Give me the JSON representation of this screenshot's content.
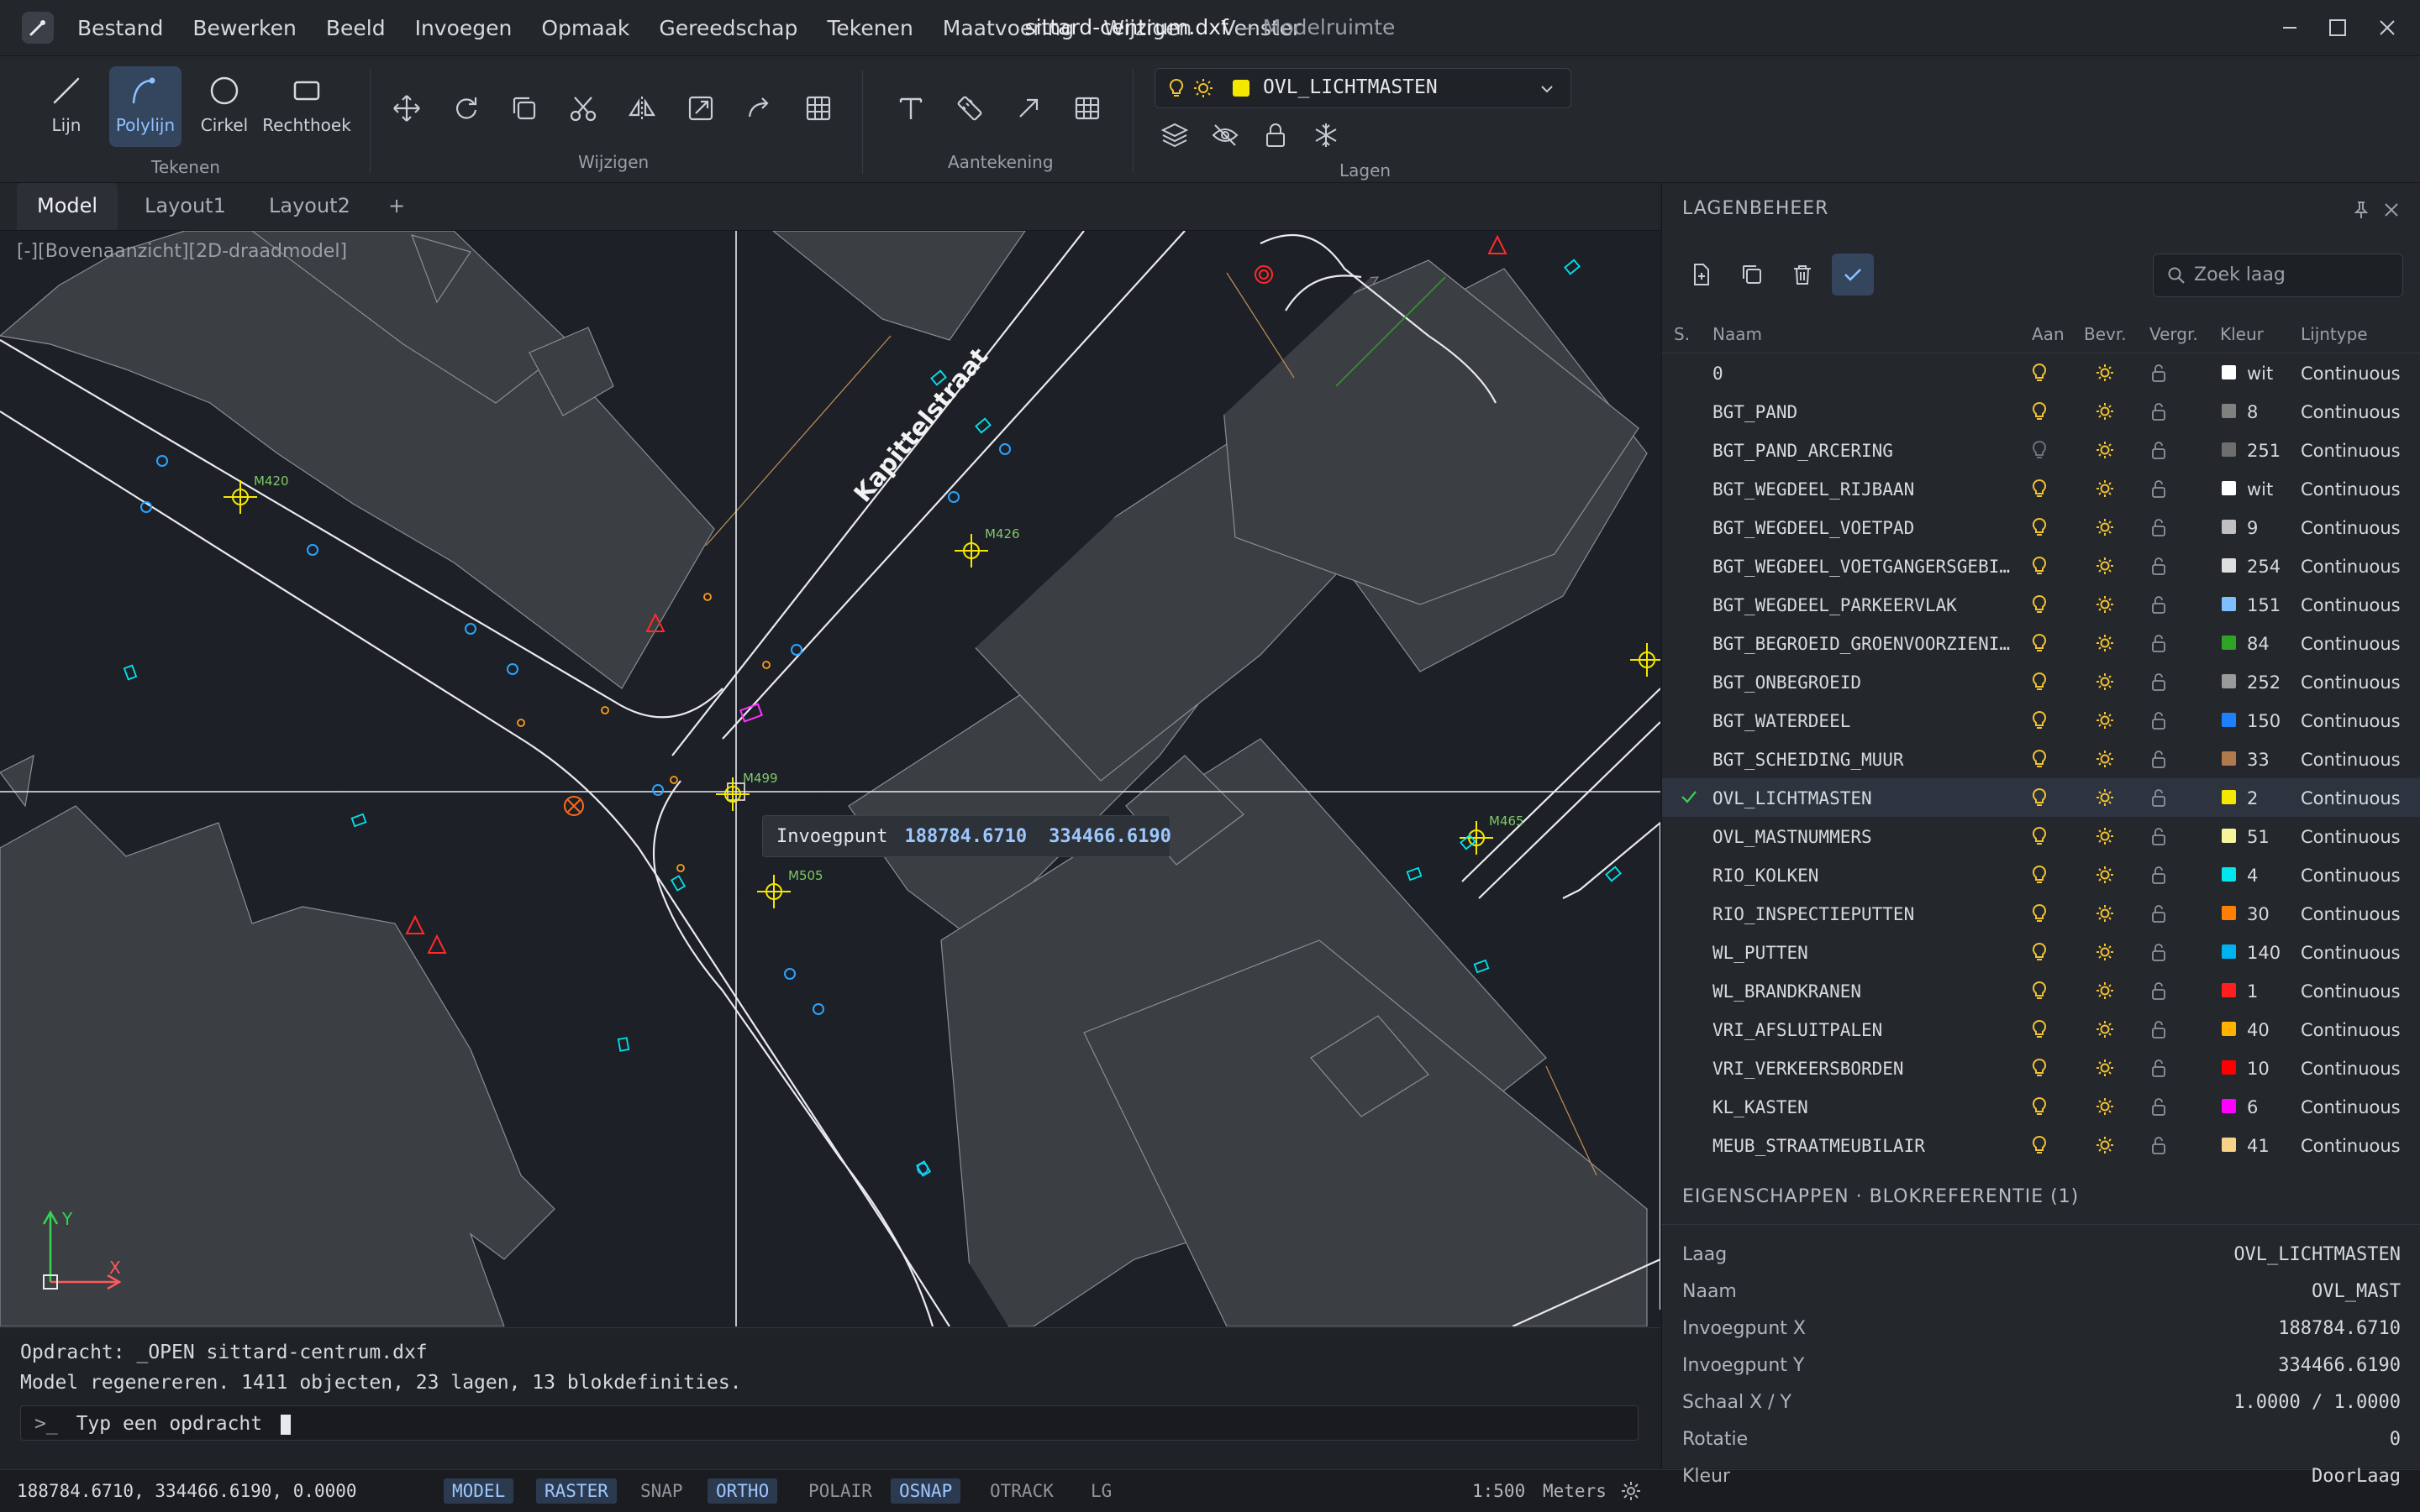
{
  "menu": [
    "Bestand",
    "Bewerken",
    "Beeld",
    "Invoegen",
    "Opmaak",
    "Gereedschap",
    "Tekenen",
    "Maatvoering",
    "Wijzigen",
    "Venster"
  ],
  "window": {
    "filename": "sittard-centrum.dxf",
    "subtitle": "— Modelruimte"
  },
  "ribbon": {
    "draw_tools": [
      "Lijn",
      "Polylijn",
      "Cirkel",
      "Rechthoek"
    ],
    "groups": {
      "draw": "Tekenen",
      "modify": "Wijzigen",
      "annotate": "Aantekening",
      "layers": "Lagen"
    },
    "current_layer": "OVL_LICHTMASTEN",
    "current_layer_color": "#f5e800"
  },
  "tabs": [
    "Model",
    "Layout1",
    "Layout2",
    "+"
  ],
  "viewport": {
    "label": "[-][Bovenaanzicht][2D-draadmodel]",
    "street_name": "Kapittelstraat",
    "mast_labels": [
      "M420",
      "M426",
      "M499",
      "M505",
      "M465"
    ],
    "axis_y": "Y",
    "axis_x": "X",
    "tooltip": {
      "label": "Invoegpunt",
      "x": "188784.6710",
      "y": "334466.6190"
    }
  },
  "command": {
    "line1": "Opdracht: _OPEN  sittard-centrum.dxf",
    "line2": "Model regenereren.  1411 objecten, 23 lagen, 13 blokdefinities.",
    "prompt": ">_",
    "placeholder": "Typ een opdracht"
  },
  "status": {
    "coords": "188784.6710, 334466.6190, 0.0000",
    "toggles": [
      {
        "label": "MODEL",
        "on": true
      },
      {
        "label": "RASTER",
        "on": true
      },
      {
        "label": "SNAP",
        "on": false
      },
      {
        "label": "ORTHO",
        "on": true
      },
      {
        "label": "POLAIR",
        "on": false
      },
      {
        "label": "OSNAP",
        "on": true
      },
      {
        "label": "OTRACK",
        "on": false
      },
      {
        "label": "LG",
        "on": false
      }
    ],
    "scale": "1:500",
    "units": "Meters"
  },
  "layer_panel": {
    "title": "LAGENBEHEER",
    "search_placeholder": "Zoek laag",
    "columns": {
      "s": "S.",
      "name": "Naam",
      "on": "Aan",
      "freeze": "Bevr.",
      "lock": "Vergr.",
      "color": "Kleur",
      "linetype": "Lijntype"
    },
    "layers": [
      {
        "name": "0",
        "color": "wit",
        "swatch": "#ffffff",
        "linetype": "Continuous",
        "on": true,
        "current": false
      },
      {
        "name": "BGT_PAND",
        "color": "8",
        "swatch": "#808080",
        "linetype": "Continuous",
        "on": true,
        "current": false
      },
      {
        "name": "BGT_PAND_ARCERING",
        "color": "251",
        "swatch": "#6e6e6e",
        "linetype": "Continuous",
        "on": false,
        "current": false
      },
      {
        "name": "BGT_WEGDEEL_RIJBAAN",
        "color": "wit",
        "swatch": "#ffffff",
        "linetype": "Continuous",
        "on": true,
        "current": false
      },
      {
        "name": "BGT_WEGDEEL_VOETPAD",
        "color": "9",
        "swatch": "#c0c0c0",
        "linetype": "Continuous",
        "on": true,
        "current": false
      },
      {
        "name": "BGT_WEGDEEL_VOETGANGERSGEBI…",
        "color": "254",
        "swatch": "#dedede",
        "linetype": "Continuous",
        "on": true,
        "current": false
      },
      {
        "name": "BGT_WEGDEEL_PARKEERVLAK",
        "color": "151",
        "swatch": "#7fbfff",
        "linetype": "Continuous",
        "on": true,
        "current": false
      },
      {
        "name": "BGT_BEGROEID_GROENVOORZIENI…",
        "color": "84",
        "swatch": "#2fa326",
        "linetype": "Continuous",
        "on": true,
        "current": false
      },
      {
        "name": "BGT_ONBEGROEID",
        "color": "252",
        "swatch": "#9a9a9a",
        "linetype": "Continuous",
        "on": true,
        "current": false
      },
      {
        "name": "BGT_WATERDEEL",
        "color": "150",
        "swatch": "#1e7fff",
        "linetype": "Continuous",
        "on": true,
        "current": false
      },
      {
        "name": "BGT_SCHEIDING_MUUR",
        "color": "33",
        "swatch": "#b07a4c",
        "linetype": "Continuous",
        "on": true,
        "current": false
      },
      {
        "name": "OVL_LICHTMASTEN",
        "color": "2",
        "swatch": "#f5e800",
        "linetype": "Continuous",
        "on": true,
        "current": true
      },
      {
        "name": "OVL_MASTNUMMERS",
        "color": "51",
        "swatch": "#f7f59a",
        "linetype": "Continuous",
        "on": true,
        "current": false
      },
      {
        "name": "RIO_KOLKEN",
        "color": "4",
        "swatch": "#00e5ee",
        "linetype": "Continuous",
        "on": true,
        "current": false
      },
      {
        "name": "RIO_INSPECTIEPUTTEN",
        "color": "30",
        "swatch": "#ff7f00",
        "linetype": "Continuous",
        "on": true,
        "current": false
      },
      {
        "name": "WL_PUTTEN",
        "color": "140",
        "swatch": "#00b3f0",
        "linetype": "Continuous",
        "on": true,
        "current": false
      },
      {
        "name": "WL_BRANDKRANEN",
        "color": "1",
        "swatch": "#ff1f1f",
        "linetype": "Continuous",
        "on": true,
        "current": false
      },
      {
        "name": "VRI_AFSLUITPALEN",
        "color": "40",
        "swatch": "#ffb300",
        "linetype": "Continuous",
        "on": true,
        "current": false
      },
      {
        "name": "VRI_VERKEERSBORDEN",
        "color": "10",
        "swatch": "#ff0000",
        "linetype": "Continuous",
        "on": true,
        "current": false
      },
      {
        "name": "KL_KASTEN",
        "color": "6",
        "swatch": "#ff00ff",
        "linetype": "Continuous",
        "on": true,
        "current": false
      },
      {
        "name": "MEUB_STRAATMEUBILAIR",
        "color": "41",
        "swatch": "#f5d48a",
        "linetype": "Continuous",
        "on": true,
        "current": false
      }
    ]
  },
  "properties": {
    "title": "EIGENSCHAPPEN · BLOKREFERENTIE (1)",
    "rows": [
      {
        "key": "Laag",
        "value": "OVL_LICHTMASTEN"
      },
      {
        "key": "Naam",
        "value": "OVL_MAST"
      },
      {
        "key": "Invoegpunt X",
        "value": "188784.6710"
      },
      {
        "key": "Invoegpunt Y",
        "value": "334466.6190"
      },
      {
        "key": "Schaal X / Y",
        "value": "1.0000 / 1.0000"
      },
      {
        "key": "Rotatie",
        "value": "0"
      },
      {
        "key": "Kleur",
        "value": "DoorLaag"
      }
    ]
  }
}
